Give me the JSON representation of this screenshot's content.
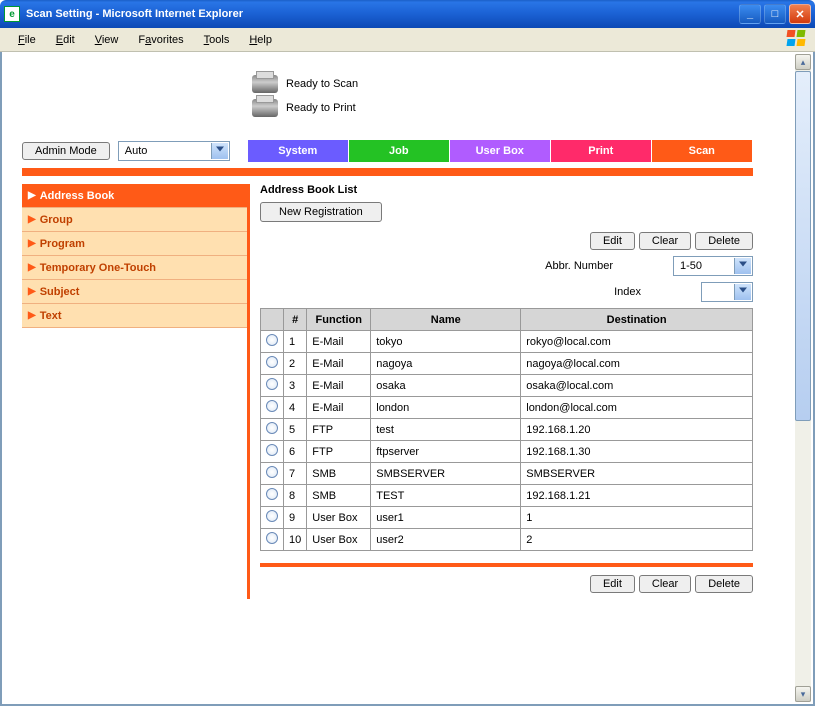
{
  "window": {
    "title": "Scan Setting - Microsoft Internet Explorer"
  },
  "menu": {
    "file": "File",
    "edit": "Edit",
    "view": "View",
    "favorites": "Favorites",
    "tools": "Tools",
    "help": "Help"
  },
  "status": {
    "scan": "Ready to Scan",
    "print": "Ready to Print"
  },
  "toolbar": {
    "admin_mode": "Admin Mode",
    "auto": "Auto",
    "tabs": [
      {
        "label": "System",
        "color": "#6b5cff"
      },
      {
        "label": "Job",
        "color": "#24c224"
      },
      {
        "label": "User Box",
        "color": "#b05cff"
      },
      {
        "label": "Print",
        "color": "#ff2a6a"
      },
      {
        "label": "Scan",
        "color": "#ff5a17"
      }
    ]
  },
  "sidebar": {
    "items": [
      {
        "label": "Address Book",
        "active": true
      },
      {
        "label": "Group"
      },
      {
        "label": "Program"
      },
      {
        "label": "Temporary One-Touch"
      },
      {
        "label": "Subject"
      },
      {
        "label": "Text"
      }
    ]
  },
  "main": {
    "heading": "Address Book List",
    "new_registration": "New Registration",
    "edit": "Edit",
    "clear": "Clear",
    "delete": "Delete",
    "abbr_label": "Abbr. Number",
    "abbr_value": "1-50",
    "index_label": "Index",
    "index_value": "",
    "columns": {
      "num": "#",
      "function": "Function",
      "name": "Name",
      "destination": "Destination"
    },
    "rows": [
      {
        "n": "1",
        "func": "E-Mail",
        "name": "tokyo",
        "dest": "rokyo@local.com"
      },
      {
        "n": "2",
        "func": "E-Mail",
        "name": "nagoya",
        "dest": "nagoya@local.com"
      },
      {
        "n": "3",
        "func": "E-Mail",
        "name": "osaka",
        "dest": "osaka@local.com"
      },
      {
        "n": "4",
        "func": "E-Mail",
        "name": "london",
        "dest": "london@local.com"
      },
      {
        "n": "5",
        "func": "FTP",
        "name": "test",
        "dest": "192.168.1.20"
      },
      {
        "n": "6",
        "func": "FTP",
        "name": "ftpserver",
        "dest": "192.168.1.30"
      },
      {
        "n": "7",
        "func": "SMB",
        "name": "SMBSERVER",
        "dest": "SMBSERVER"
      },
      {
        "n": "8",
        "func": "SMB",
        "name": "TEST",
        "dest": "192.168.1.21"
      },
      {
        "n": "9",
        "func": "User Box",
        "name": "user1",
        "dest": "1"
      },
      {
        "n": "10",
        "func": "User Box",
        "name": "user2",
        "dest": "2"
      }
    ]
  }
}
